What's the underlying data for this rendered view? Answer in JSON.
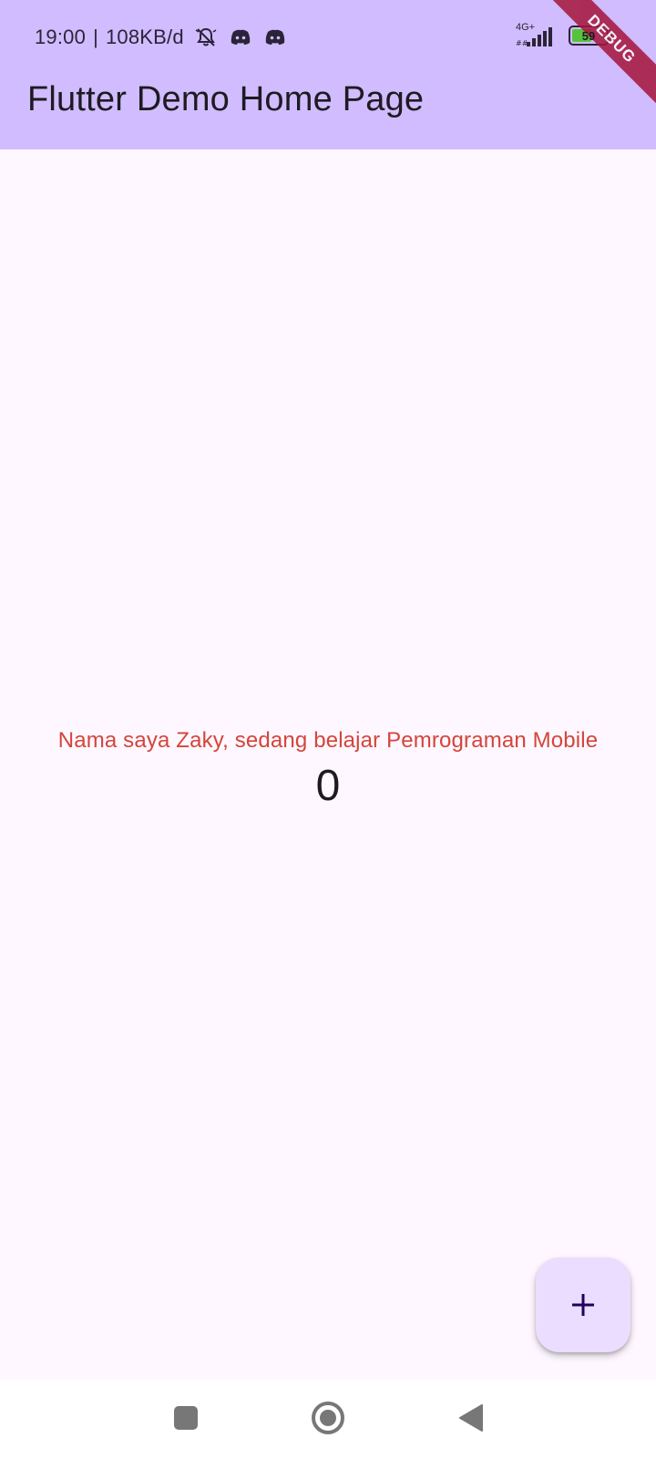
{
  "status_bar": {
    "time": "19:00",
    "separator": "|",
    "speed": "108KB/d",
    "network_type": "4G+",
    "battery_level": "59",
    "battery_fraction": 0.59,
    "icons": [
      "mute-notification-icon",
      "discord-icon",
      "discord-icon",
      "signal-icon",
      "battery-icon"
    ]
  },
  "app_bar": {
    "title": "Flutter Demo Home Page",
    "background": "#d0bcff"
  },
  "debug_banner": {
    "label": "DEBUG",
    "color": "#a5153a"
  },
  "body": {
    "message": "Nama saya Zaky, sedang belajar Pemrograman Mobile",
    "message_color": "#d4453a",
    "counter": "0"
  },
  "fab": {
    "icon": "plus-icon",
    "background": "#eaddff"
  },
  "navigation": {
    "buttons": [
      "recents-button",
      "home-button",
      "back-button"
    ]
  }
}
